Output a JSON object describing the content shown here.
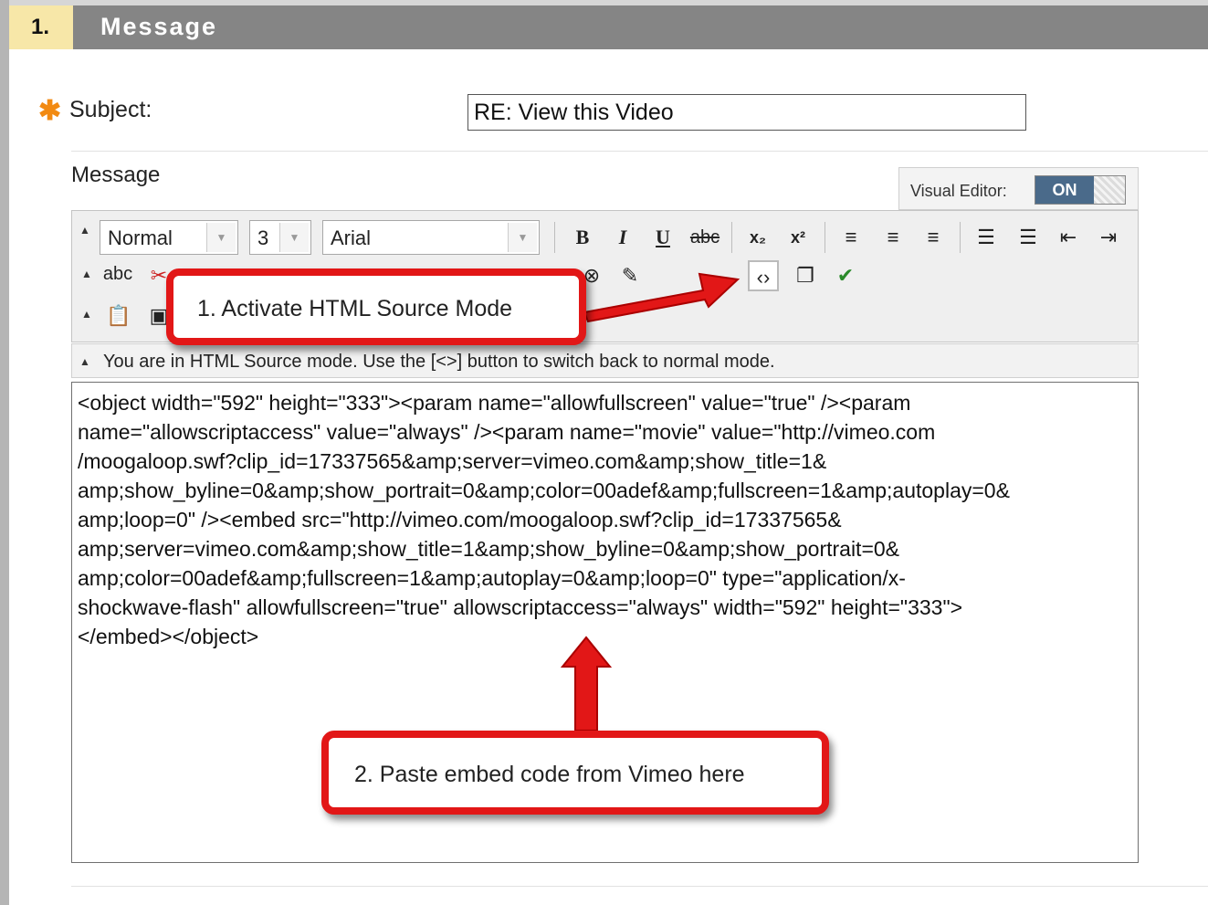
{
  "section": {
    "number": "1.",
    "title": "Message"
  },
  "form": {
    "subject_label": "Subject:",
    "subject_value": "RE: View this Video",
    "message_label": "Message"
  },
  "visual_editor": {
    "label": "Visual Editor:",
    "state": "ON"
  },
  "toolbar": {
    "format_value": "Normal",
    "size_value": "3",
    "font_value": "Arial",
    "bold": "B",
    "italic": "I",
    "underline": "U",
    "strikethrough": "abc",
    "subscript": "x₂",
    "superscript": "x²",
    "spellcheck": "abc",
    "icons": [
      "bold-icon",
      "italic-icon",
      "underline-icon",
      "strikethrough-icon",
      "subscript-icon",
      "superscript-icon",
      "align-left-icon",
      "align-center-icon",
      "align-right-icon",
      "numbered-list-icon",
      "bullet-list-icon",
      "outdent-icon",
      "indent-icon",
      "spellcheck-icon",
      "cut-icon",
      "paste-icon",
      "html-source-icon",
      "fullscreen-icon",
      "check-icon"
    ]
  },
  "status": "You are in HTML Source mode. Use the [<>] button to switch back to normal mode.",
  "editor_content": "<object width=\"592\" height=\"333\"><param name=\"allowfullscreen\" value=\"true\" /><param\nname=\"allowscriptaccess\" value=\"always\" /><param name=\"movie\" value=\"http://vimeo.com\n/moogaloop.swf?clip_id=17337565&amp;server=vimeo.com&amp;show_title=1&\namp;show_byline=0&amp;show_portrait=0&amp;color=00adef&amp;fullscreen=1&amp;autoplay=0&\namp;loop=0\" /><embed src=\"http://vimeo.com/moogaloop.swf?clip_id=17337565&\namp;server=vimeo.com&amp;show_title=1&amp;show_byline=0&amp;show_portrait=0&\namp;color=00adef&amp;fullscreen=1&amp;autoplay=0&amp;loop=0\" type=\"application/x-\nshockwave-flash\" allowfullscreen=\"true\" allowscriptaccess=\"always\" width=\"592\" height=\"333\">\n</embed></object>",
  "callouts": {
    "step1": "1. Activate HTML Source Mode",
    "step2": "2. Paste embed code from Vimeo here"
  },
  "colors": {
    "callout_red": "#e21717",
    "header_gray": "#858585",
    "number_bg": "#f7e7a8",
    "required_star": "#f28a12"
  }
}
